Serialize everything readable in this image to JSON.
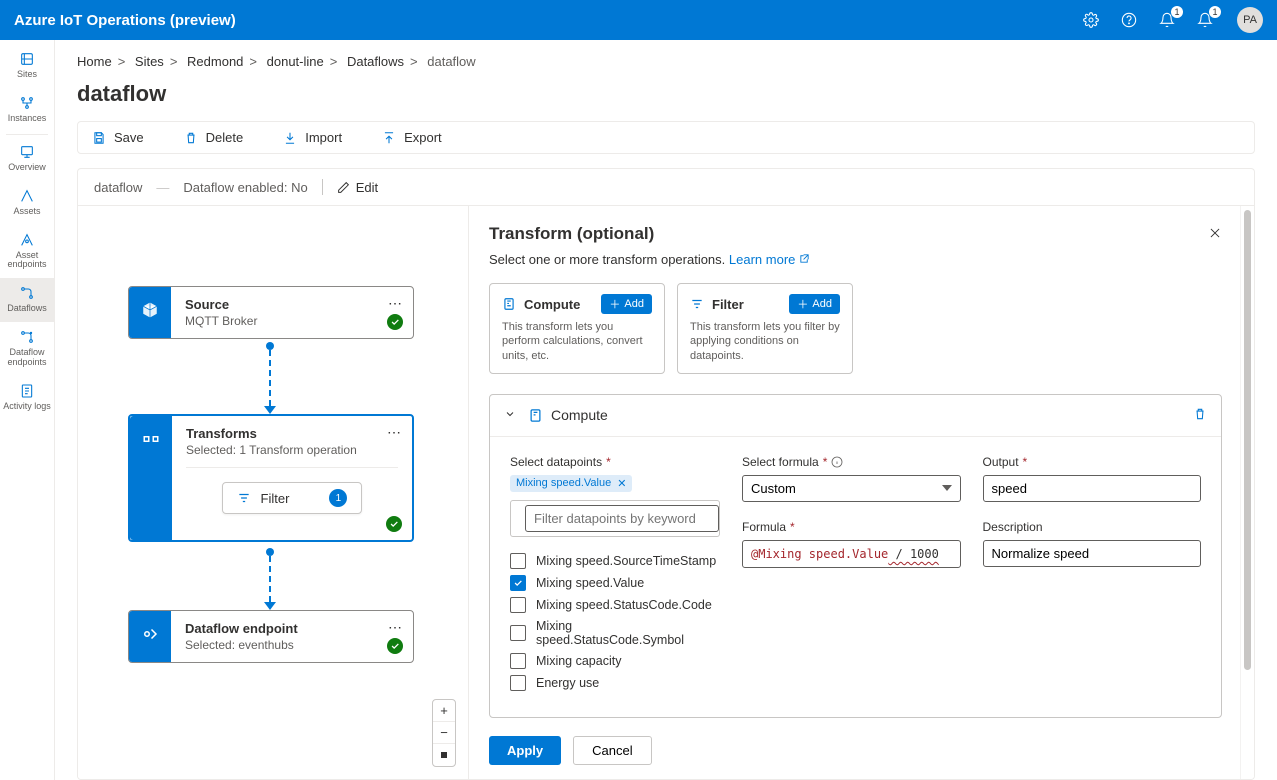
{
  "header": {
    "title": "Azure IoT Operations (preview)",
    "badge1": "1",
    "badge2": "1",
    "avatar": "PA"
  },
  "nav": {
    "items": [
      {
        "label": "Sites"
      },
      {
        "label": "Instances"
      },
      {
        "label": "Overview"
      },
      {
        "label": "Assets"
      },
      {
        "label": "Asset endpoints"
      },
      {
        "label": "Dataflows"
      },
      {
        "label": "Dataflow endpoints"
      },
      {
        "label": "Activity logs"
      }
    ]
  },
  "breadcrumb": [
    "Home",
    "Sites",
    "Redmond",
    "donut-line",
    "Dataflows",
    "dataflow"
  ],
  "page_title": "dataflow",
  "toolbar": {
    "save": "Save",
    "delete": "Delete",
    "import": "Import",
    "export": "Export"
  },
  "status": {
    "name": "dataflow",
    "enabled": "Dataflow enabled: No",
    "edit": "Edit"
  },
  "nodes": {
    "source": {
      "title": "Source",
      "sub": "MQTT Broker"
    },
    "transform": {
      "title": "Transforms",
      "sub": "Selected: 1 Transform operation",
      "filter_label": "Filter",
      "filter_count": "1"
    },
    "endpoint": {
      "title": "Dataflow endpoint",
      "sub": "Selected: eventhubs"
    }
  },
  "panel": {
    "title": "Transform (optional)",
    "subtitle": "Select one or more transform operations.",
    "learn_more": "Learn more",
    "cards": {
      "compute": {
        "title": "Compute",
        "add": "Add",
        "desc": "This transform lets you perform calculations, convert units, etc."
      },
      "filter": {
        "title": "Filter",
        "add": "Add",
        "desc": "This transform lets you filter by applying conditions on datapoints."
      }
    },
    "section_title": "Compute",
    "datapoints_label": "Select datapoints",
    "tag": "Mixing speed.Value",
    "search_placeholder": "Filter datapoints by keyword",
    "datapoints": [
      {
        "label": "Mixing speed.SourceTimeStamp",
        "checked": false
      },
      {
        "label": "Mixing speed.Value",
        "checked": true
      },
      {
        "label": "Mixing speed.StatusCode.Code",
        "checked": false
      },
      {
        "label": "Mixing speed.StatusCode.Symbol",
        "checked": false
      },
      {
        "label": "Mixing capacity",
        "checked": false
      },
      {
        "label": "Energy use",
        "checked": false
      }
    ],
    "formula_label": "Select formula",
    "formula_select": "Custom",
    "formula_input_label": "Formula",
    "formula_value_prefix": "@Mixing speed.Value",
    "formula_value_suffix": " / 1000",
    "output_label": "Output",
    "output_value": "speed",
    "description_label": "Description",
    "description_value": "Normalize speed",
    "apply": "Apply",
    "cancel": "Cancel"
  }
}
